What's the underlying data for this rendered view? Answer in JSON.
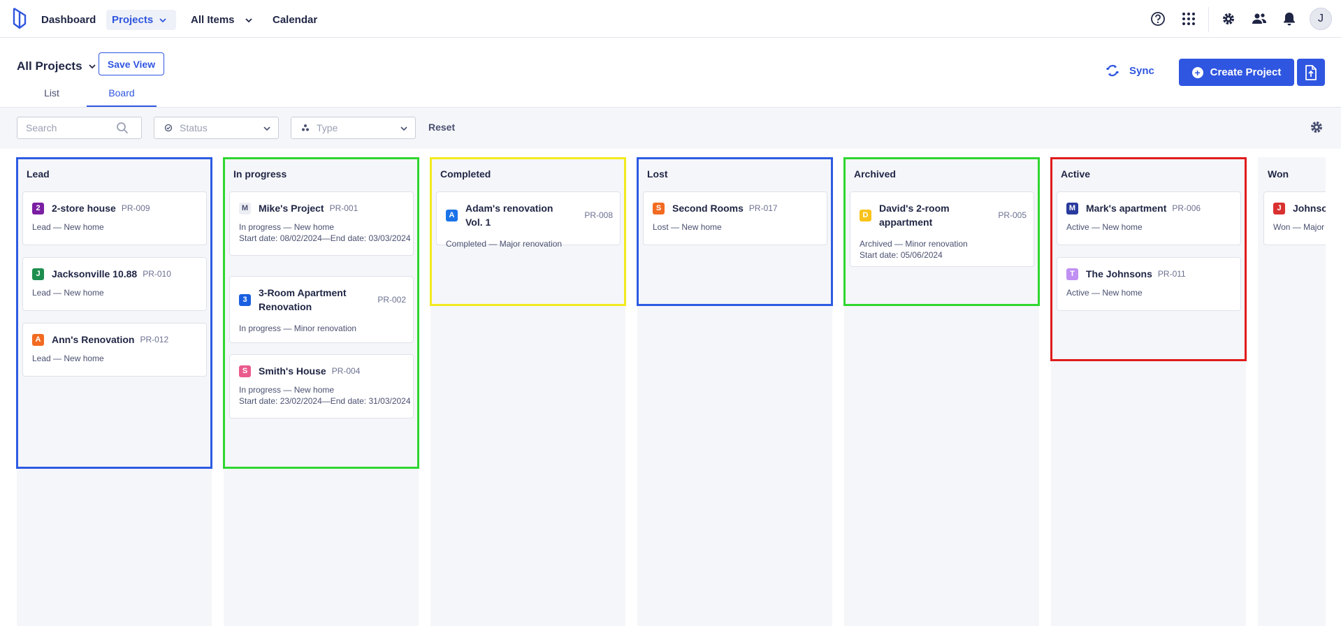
{
  "nav": {
    "dashboard": "Dashboard",
    "projects": "Projects",
    "all_items": "All Items",
    "calendar": "Calendar",
    "avatar_initial": "J"
  },
  "header": {
    "title": "All Projects",
    "save_view": "Save View",
    "tabs": [
      "List",
      "Board"
    ],
    "active_tab": "Board",
    "sync": "Sync",
    "create_project": "Create Project"
  },
  "filters": {
    "search_placeholder": "Search",
    "status": "Status",
    "type": "Type",
    "reset": "Reset"
  },
  "colors": {
    "accent": "#2f56e0",
    "frame_blue": "#2d5be3",
    "frame_green": "#2fd62f",
    "frame_yellow": "#f2ea1e",
    "frame_red": "#e01b1b"
  },
  "icons": [
    "logo-icon",
    "chevron-down-icon",
    "help-icon",
    "apps-grid-icon",
    "gear-icon",
    "team-icon",
    "bell-icon",
    "sync-icon",
    "plus-circle-icon",
    "export-file-icon",
    "search-icon",
    "status-icon",
    "type-icon"
  ],
  "columns": [
    {
      "title": "Lead",
      "cards": [
        {
          "badge": "2",
          "badge_color": "#7b1fa2",
          "title": "2-store house",
          "code": "PR-009",
          "meta": [
            "Lead — New home"
          ]
        },
        {
          "badge": "J",
          "badge_color": "#1e8e4e",
          "title": "Jacksonville 10.88",
          "code": "PR-010",
          "meta": [
            "Lead — New home"
          ]
        },
        {
          "badge": "A",
          "badge_color": "#f26b21",
          "title": "Ann's Renovation",
          "code": "PR-012",
          "meta": [
            "Lead — New home"
          ]
        }
      ]
    },
    {
      "title": "In progress",
      "cards": [
        {
          "badge": "M",
          "badge_color": "#eceef4",
          "badge_text_color": "#4a5070",
          "title": "Mike's Project",
          "code": "PR-001",
          "meta": [
            "In progress — New home",
            "Start date: 08/02/2024—End date: 03/03/2024"
          ]
        },
        {
          "badge": "3",
          "badge_color": "#1a5fe0",
          "title": "3-Room Apartment Renovation",
          "code": "PR-002",
          "meta": [
            "In progress — Minor renovation"
          ]
        },
        {
          "badge": "S",
          "badge_color": "#ea5a8e",
          "title": "Smith's House",
          "code": "PR-004",
          "meta": [
            "In progress — New home",
            "Start date: 23/02/2024—End date: 31/03/2024"
          ]
        }
      ]
    },
    {
      "title": "Completed",
      "cards": [
        {
          "badge": "A",
          "badge_color": "#1a73e8",
          "title": "Adam's renovation Vol. 1",
          "code": "PR-008",
          "meta": [
            "Completed — Major renovation"
          ]
        }
      ]
    },
    {
      "title": "Lost",
      "cards": [
        {
          "badge": "S",
          "badge_color": "#f26b21",
          "title": "Second Rooms",
          "code": "PR-017",
          "meta": [
            "Lost — New home"
          ]
        }
      ]
    },
    {
      "title": "Archived",
      "cards": [
        {
          "badge": "D",
          "badge_color": "#f9c31c",
          "title": "David's 2-room appartment",
          "code": "PR-005",
          "meta": [
            "Archived — Minor renovation",
            "Start date: 05/06/2024"
          ]
        }
      ]
    },
    {
      "title": "Active",
      "cards": [
        {
          "badge": "M",
          "badge_color": "#2a3b9e",
          "title": "Mark's apartment",
          "code": "PR-006",
          "meta": [
            "Active — New home"
          ]
        },
        {
          "badge": "T",
          "badge_color": "#c08ff2",
          "title": "The Johnsons",
          "code": "PR-011",
          "meta": [
            "Active — New home"
          ]
        }
      ]
    },
    {
      "title": "Won",
      "cards": [
        {
          "badge": "J",
          "badge_color": "#d93030",
          "title": "Johnsons",
          "code": "",
          "meta": [
            "Won — Major renovation"
          ]
        }
      ]
    }
  ]
}
